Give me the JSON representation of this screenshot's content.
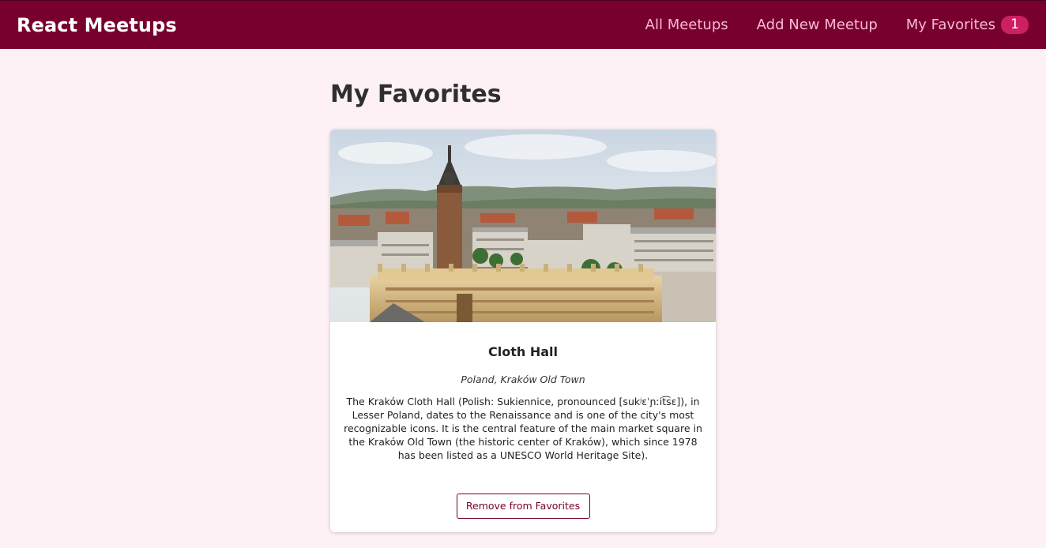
{
  "header": {
    "logo": "React Meetups",
    "nav": {
      "all_meetups": "All Meetups",
      "add_new": "Add New Meetup",
      "favorites": "My Favorites",
      "favorites_count": "1"
    }
  },
  "page": {
    "title": "My Favorites"
  },
  "meetup": {
    "image_icon": "krakow-old-town-photo",
    "title": "Cloth Hall",
    "address": "Poland, Kraków Old Town",
    "description": "The Kraków Cloth Hall (Polish: Sukiennice, pronounced [sukʲɛˈɲːit͡sɛ]), in Lesser Poland, dates to the Renaissance and is one of the city's most recognizable icons. It is the central feature of the main market square in the Kraków Old Town (the historic center of Kraków), which since 1978 has been listed as a UNESCO World Heritage Site).",
    "remove_label": "Remove from Favorites"
  },
  "colors": {
    "header_bg": "#77002e",
    "nav_link": "#fcb8d2",
    "badge_bg": "#cc2062",
    "page_bg": "#fdf1f5"
  }
}
